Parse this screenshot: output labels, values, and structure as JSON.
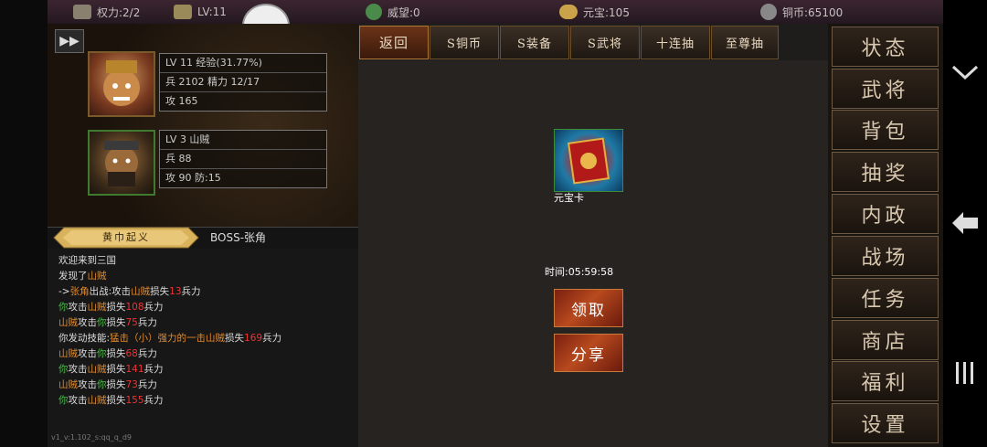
{
  "topbar": {
    "power": "权力:2/2",
    "level": "LV:11",
    "prestige": "威望:0",
    "ingot": "元宝:105",
    "copper": "铜币:65100"
  },
  "ff_button": "▶▶",
  "hero": {
    "row1": "LV 11  经验(31.77%)",
    "row2": "兵 2102  精力 12/17",
    "row3": "攻 165"
  },
  "enemy": {
    "row1": "LV 3    山贼",
    "row2": "兵 88",
    "row3": "攻 90  防:15"
  },
  "tabs_left": {
    "active": "黄巾起义",
    "boss": "BOSS-张角"
  },
  "log": [
    {
      "parts": [
        {
          "t": "欢迎来到三国",
          "c": ""
        }
      ]
    },
    {
      "parts": [
        {
          "t": "发现了",
          "c": ""
        },
        {
          "t": "山贼",
          "c": "o"
        }
      ]
    },
    {
      "parts": [
        {
          "t": "->",
          "c": ""
        },
        {
          "t": "张角",
          "c": "o"
        },
        {
          "t": "出战:攻击",
          "c": ""
        },
        {
          "t": "山贼",
          "c": "o"
        },
        {
          "t": "损失",
          "c": ""
        },
        {
          "t": "13",
          "c": "r"
        },
        {
          "t": "兵力",
          "c": ""
        }
      ]
    },
    {
      "parts": [
        {
          "t": "你",
          "c": "g"
        },
        {
          "t": "攻击",
          "c": ""
        },
        {
          "t": "山贼",
          "c": "o"
        },
        {
          "t": "损失",
          "c": ""
        },
        {
          "t": "108",
          "c": "r"
        },
        {
          "t": "兵力",
          "c": ""
        }
      ]
    },
    {
      "parts": [
        {
          "t": "山贼",
          "c": "o"
        },
        {
          "t": "攻击",
          "c": ""
        },
        {
          "t": "你",
          "c": "g"
        },
        {
          "t": "损失",
          "c": ""
        },
        {
          "t": "75",
          "c": "r"
        },
        {
          "t": "兵力",
          "c": ""
        }
      ]
    },
    {
      "parts": [
        {
          "t": "你发动技能:",
          "c": ""
        },
        {
          "t": "猛击（小）强力的一击",
          "c": "o"
        },
        {
          "t": "山贼",
          "c": "o"
        },
        {
          "t": "损失",
          "c": ""
        },
        {
          "t": "169",
          "c": "r"
        },
        {
          "t": "兵力",
          "c": ""
        }
      ]
    },
    {
      "parts": [
        {
          "t": "山贼",
          "c": "o"
        },
        {
          "t": "攻击",
          "c": ""
        },
        {
          "t": "你",
          "c": "g"
        },
        {
          "t": "损失",
          "c": ""
        },
        {
          "t": "68",
          "c": "r"
        },
        {
          "t": "兵力",
          "c": ""
        }
      ]
    },
    {
      "parts": [
        {
          "t": "你",
          "c": "g"
        },
        {
          "t": "攻击",
          "c": ""
        },
        {
          "t": "山贼",
          "c": "o"
        },
        {
          "t": "损失",
          "c": ""
        },
        {
          "t": "141",
          "c": "r"
        },
        {
          "t": "兵力",
          "c": ""
        }
      ]
    },
    {
      "parts": [
        {
          "t": "山贼",
          "c": "o"
        },
        {
          "t": "攻击",
          "c": ""
        },
        {
          "t": "你",
          "c": "g"
        },
        {
          "t": "损失",
          "c": ""
        },
        {
          "t": "73",
          "c": "r"
        },
        {
          "t": "兵力",
          "c": ""
        }
      ]
    },
    {
      "parts": [
        {
          "t": "你",
          "c": "g"
        },
        {
          "t": "攻击",
          "c": ""
        },
        {
          "t": "山贼",
          "c": "o"
        },
        {
          "t": "损失",
          "c": ""
        },
        {
          "t": "155",
          "c": "r"
        },
        {
          "t": "兵力",
          "c": ""
        }
      ]
    }
  ],
  "version": "v1_v:1.102_s:qq_q_d9",
  "main_tabs": [
    "返回",
    "S铜币",
    "S装备",
    "S武将",
    "十连抽",
    "至尊抽"
  ],
  "reward": {
    "card_name": "元宝卡",
    "time": "时间:05:59:58",
    "claim": "领取",
    "share": "分享"
  },
  "right_menu": [
    "状态",
    "武将",
    "背包",
    "抽奖",
    "内政",
    "战场",
    "任务",
    "商店",
    "福利",
    "设置"
  ],
  "side_icons": {
    "collapse": "chevron-down",
    "back": "back-arrow",
    "menu": "menu-lines"
  },
  "colors": {
    "green": "#4cc04a",
    "orange": "#e58a2a",
    "red": "#e33"
  }
}
